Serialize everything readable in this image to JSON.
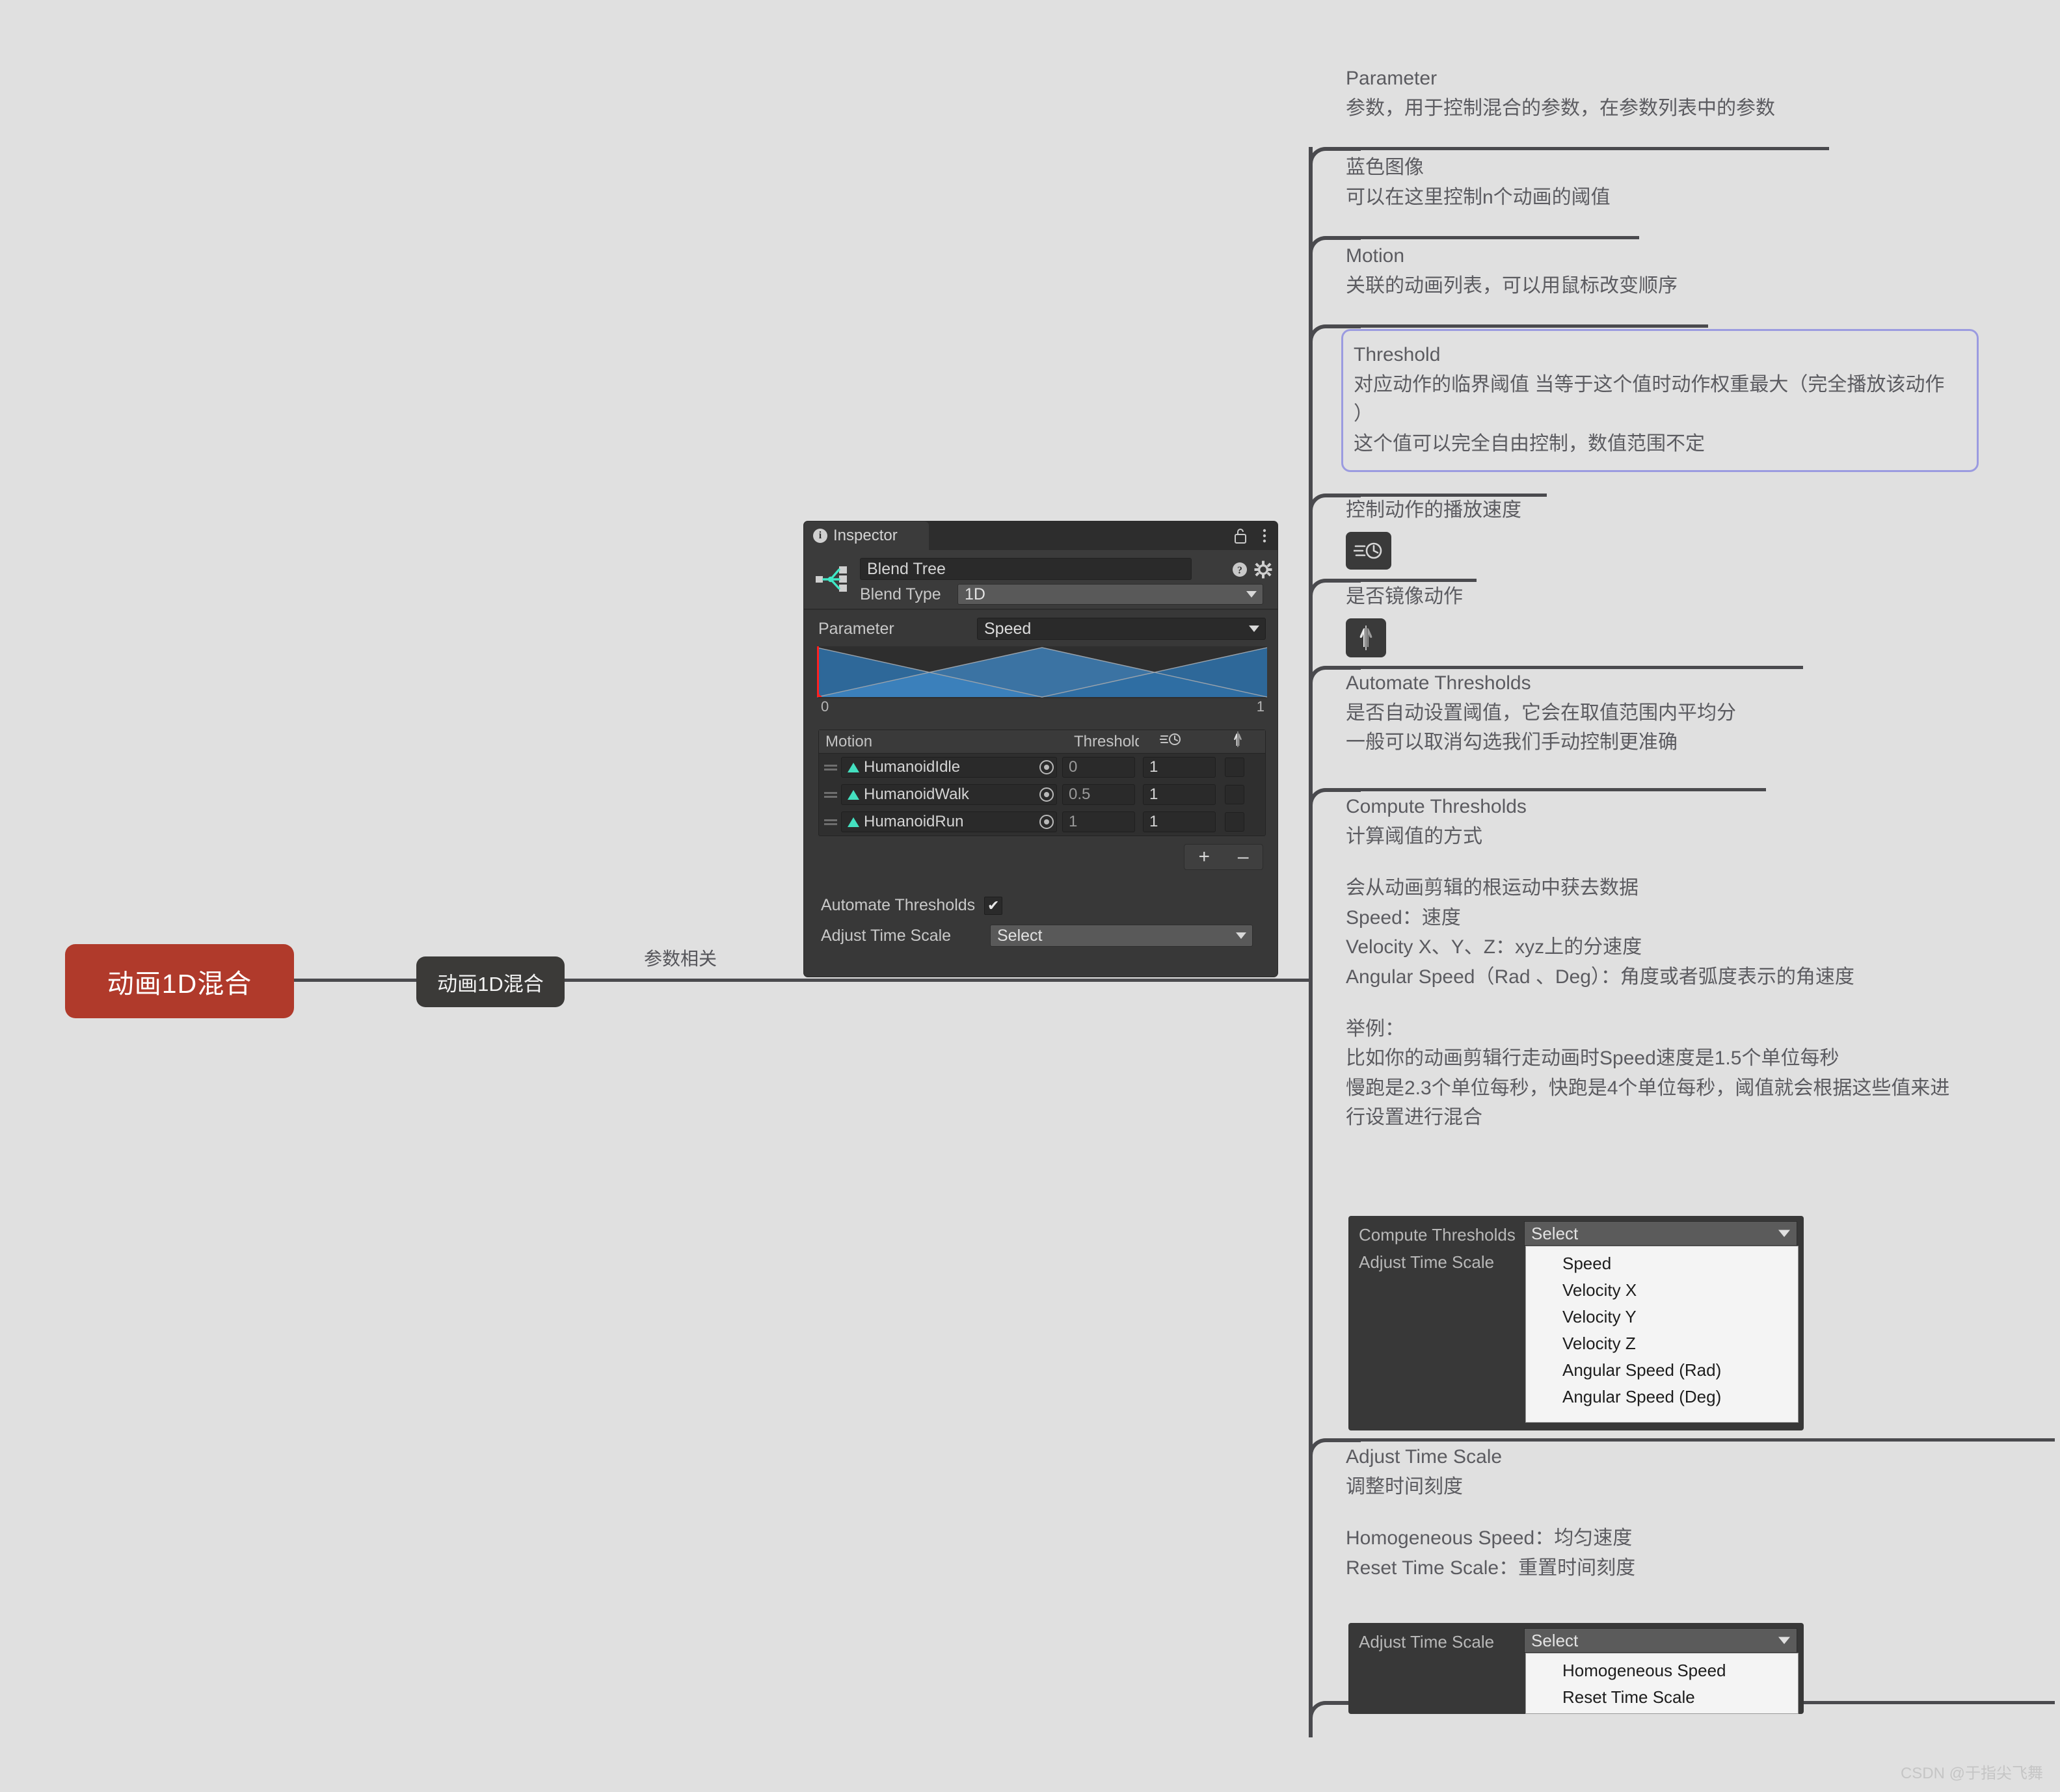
{
  "mindmap": {
    "root_label": "动画1D混合",
    "sub_label": "动画1D混合",
    "link_label": "参数相关"
  },
  "topics": [
    {
      "id": "parameter",
      "head": "Parameter",
      "lines": [
        "参数，用于控制混合的参数，在参数列表中的参数"
      ]
    },
    {
      "id": "blue-image",
      "head": "蓝色图像",
      "lines": [
        "可以在这里控制n个动画的阈值"
      ]
    },
    {
      "id": "motion",
      "head": "Motion",
      "lines": [
        "关联的动画列表，可以用鼠标改变顺序"
      ]
    },
    {
      "id": "threshold",
      "head": "Threshold",
      "lines": [
        "对应动作的临界阈值 当等于这个值时动作权重最大（完全播放该动作",
        "）",
        "这个值可以完全自由控制，数值范围不定"
      ]
    },
    {
      "id": "speed",
      "head": "控制动作的播放速度",
      "lines": []
    },
    {
      "id": "mirror",
      "head": "是否镜像动作",
      "lines": []
    },
    {
      "id": "automate-thresholds",
      "head": "Automate Thresholds",
      "lines": [
        "是否自动设置阈值，它会在取值范围内平均分",
        "一般可以取消勾选我们手动控制更准确"
      ]
    },
    {
      "id": "compute-thresholds",
      "head": "Compute Thresholds",
      "lines": [
        "计算阈值的方式",
        "",
        "会从动画剪辑的根运动中获去数据",
        "Speed：速度",
        "Velocity X、Y、Z：xyz上的分速度",
        "Angular Speed（Rad 、Deg）：角度或者弧度表示的角速度",
        "",
        "举例：",
        "比如你的动画剪辑行走动画时Speed速度是1.5个单位每秒",
        "慢跑是2.3个单位每秒，快跑是4个单位每秒，阈值就会根据这些值来进",
        "行设置进行混合"
      ]
    },
    {
      "id": "adjust-time-scale",
      "head": "Adjust Time Scale",
      "lines": [
        "调整时间刻度",
        "",
        "Homogeneous Speed：均匀速度",
        "Reset Time Scale：重置时间刻度"
      ]
    }
  ],
  "inspector": {
    "tab_label": "Inspector",
    "asset_name": "Blend Tree",
    "blend_type_label": "Blend Type",
    "blend_type_value": "1D",
    "parameter_label": "Parameter",
    "parameter_value": "Speed",
    "graph_min": "0",
    "graph_max": "1",
    "table_headers": {
      "motion": "Motion",
      "threshold": "Threshold",
      "speed": "speed-icon",
      "mirror": "mirror-icon"
    },
    "rows": [
      {
        "motion": "HumanoidIdle",
        "threshold": "0",
        "speed": "1",
        "mirror": false
      },
      {
        "motion": "HumanoidWalk",
        "threshold": "0.5",
        "speed": "1",
        "mirror": false
      },
      {
        "motion": "HumanoidRun",
        "threshold": "1",
        "speed": "1",
        "mirror": false
      }
    ],
    "add_label": "+",
    "remove_label": "–",
    "automate_thresholds_label": "Automate Thresholds",
    "automate_thresholds_checked": "✔",
    "adjust_time_scale_label": "Adjust Time Scale",
    "adjust_time_scale_value": "Select"
  },
  "compute_popup": {
    "label_1": "Compute Thresholds",
    "label_2": "Adjust Time Scale",
    "select_value": "Select",
    "options": [
      "Speed",
      "Velocity X",
      "Velocity Y",
      "Velocity Z",
      "Angular Speed (Rad)",
      "Angular Speed (Deg)"
    ]
  },
  "timescale_popup": {
    "label_1": "Adjust Time Scale",
    "select_value": "Select",
    "options": [
      "Homogeneous Speed",
      "Reset Time Scale"
    ]
  },
  "watermark": "CSDN @于指尖飞舞",
  "colors": {
    "background": "#e0e0e0",
    "root_node": "#b03a2b",
    "sub_node": "#3b3a38",
    "line": "#4a4a4e",
    "highlight_border": "#9b9be0",
    "unity_panel": "#383838",
    "clip_accent": "#44e0c0",
    "graph_blue": "#2f6ea3",
    "playhead": "#ff2020"
  }
}
